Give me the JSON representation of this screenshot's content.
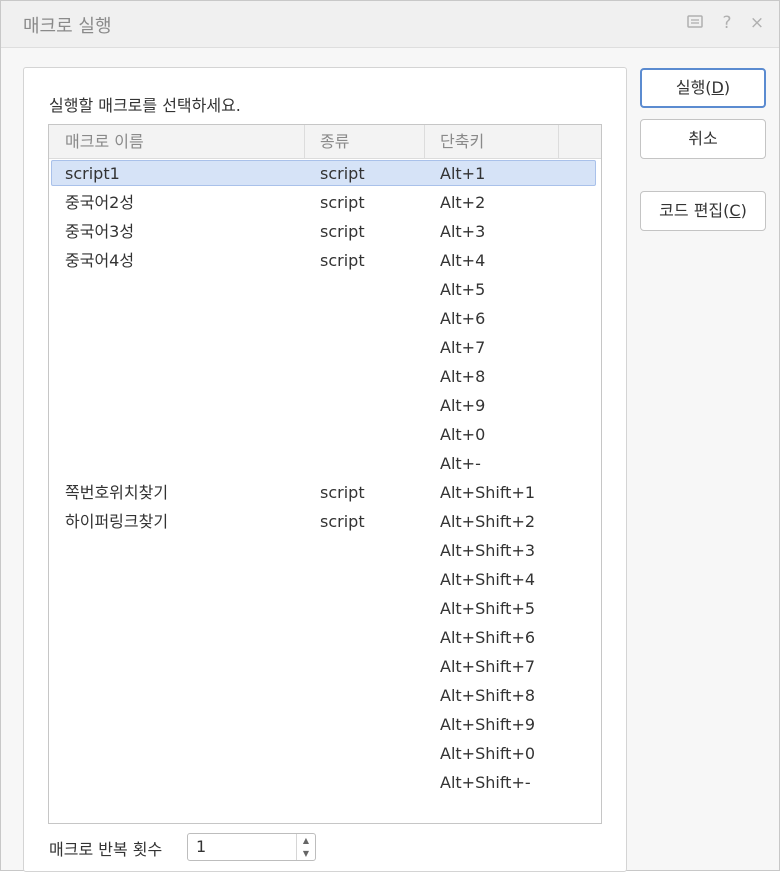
{
  "window": {
    "title": "매크로 실행",
    "icons": [
      "feedback-icon",
      "help-icon",
      "close-icon"
    ],
    "help_glyph": "?",
    "close_glyph": "×"
  },
  "panel": {
    "instruction": "실행할 매크로를 선택하세요."
  },
  "list": {
    "columns": [
      "매크로 이름",
      "종류",
      "단축키"
    ],
    "selected_index": 0,
    "rows": [
      {
        "name": "script1",
        "type": "script",
        "key": "Alt+1"
      },
      {
        "name": "중국어2성",
        "type": "script",
        "key": "Alt+2"
      },
      {
        "name": "중국어3성",
        "type": "script",
        "key": "Alt+3"
      },
      {
        "name": "중국어4성",
        "type": "script",
        "key": "Alt+4"
      },
      {
        "name": "",
        "type": "",
        "key": "Alt+5"
      },
      {
        "name": "",
        "type": "",
        "key": "Alt+6"
      },
      {
        "name": "",
        "type": "",
        "key": "Alt+7"
      },
      {
        "name": "",
        "type": "",
        "key": "Alt+8"
      },
      {
        "name": "",
        "type": "",
        "key": "Alt+9"
      },
      {
        "name": "",
        "type": "",
        "key": "Alt+0"
      },
      {
        "name": "",
        "type": "",
        "key": "Alt+-"
      },
      {
        "name": "쪽번호위치찾기",
        "type": "script",
        "key": "Alt+Shift+1"
      },
      {
        "name": "하이퍼링크찾기",
        "type": "script",
        "key": "Alt+Shift+2"
      },
      {
        "name": "",
        "type": "",
        "key": "Alt+Shift+3"
      },
      {
        "name": "",
        "type": "",
        "key": "Alt+Shift+4"
      },
      {
        "name": "",
        "type": "",
        "key": "Alt+Shift+5"
      },
      {
        "name": "",
        "type": "",
        "key": "Alt+Shift+6"
      },
      {
        "name": "",
        "type": "",
        "key": "Alt+Shift+7"
      },
      {
        "name": "",
        "type": "",
        "key": "Alt+Shift+8"
      },
      {
        "name": "",
        "type": "",
        "key": "Alt+Shift+9"
      },
      {
        "name": "",
        "type": "",
        "key": "Alt+Shift+0"
      },
      {
        "name": "",
        "type": "",
        "key": "Alt+Shift+-"
      }
    ]
  },
  "repeat": {
    "label": "매크로 반복 횟수",
    "value": "1"
  },
  "buttons": {
    "run": {
      "label": "실행(",
      "mnemonic": "D",
      "suffix": ")"
    },
    "cancel": {
      "label": "취소"
    },
    "edit": {
      "label": "코드 편집(",
      "mnemonic": "C",
      "suffix": ")"
    }
  },
  "colors": {
    "selection_bg": "#d6e3f7",
    "selection_border": "#a9c1ea",
    "primary_border": "#5b8bd0"
  }
}
